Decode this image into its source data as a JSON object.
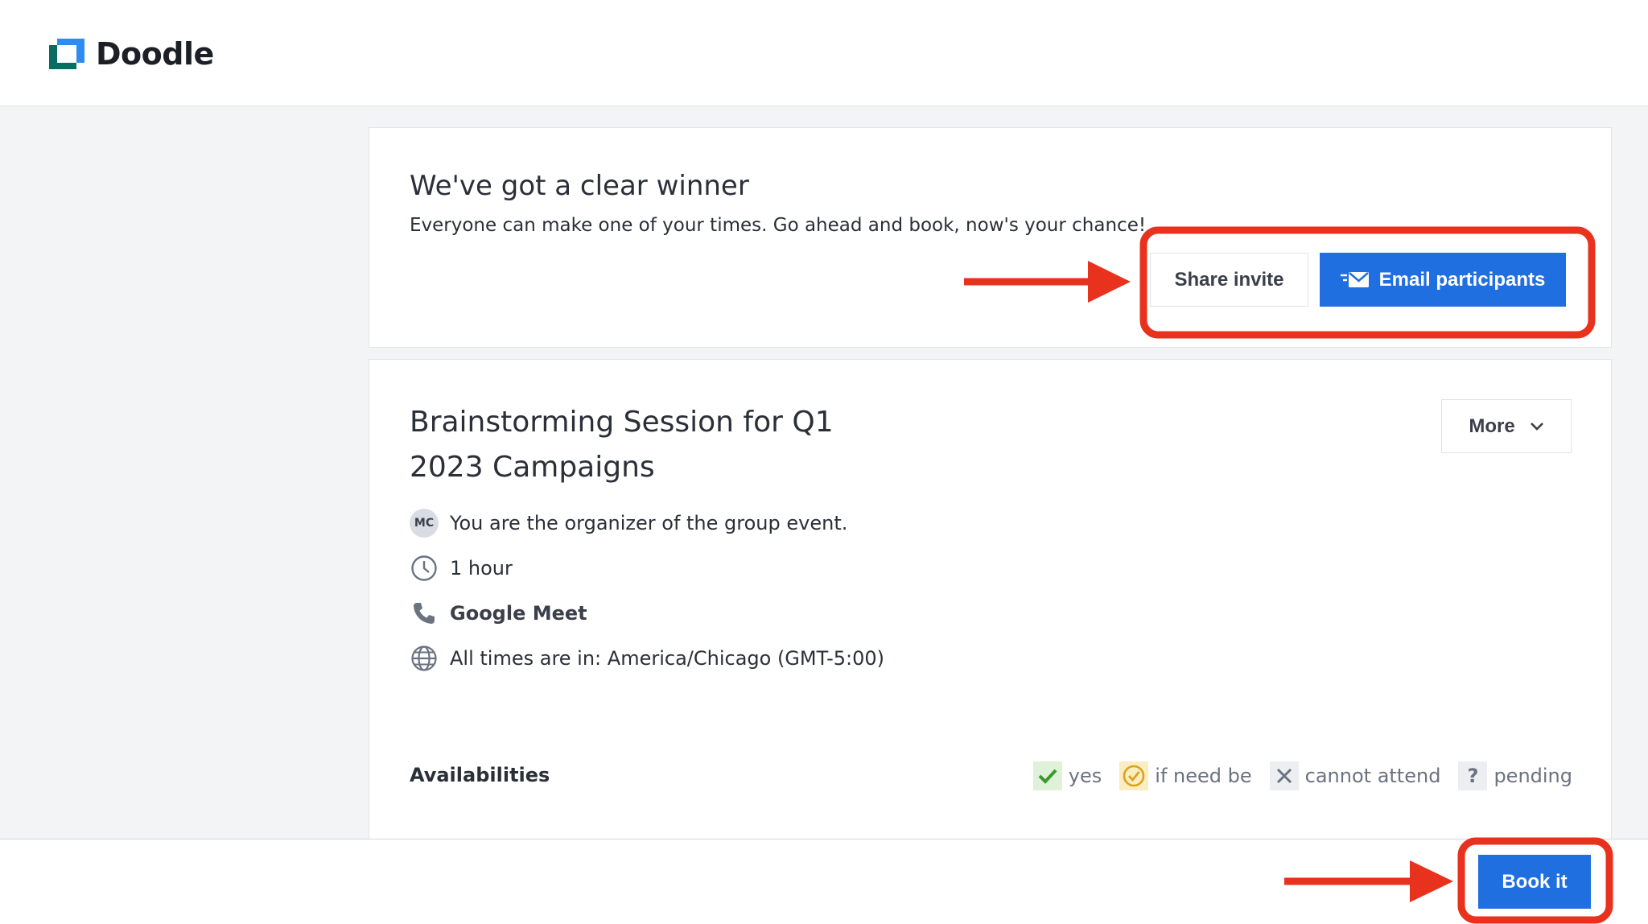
{
  "header": {
    "brand": "Doodle"
  },
  "winner": {
    "title": "We've got a clear winner",
    "subtitle": "Everyone can make one of your times. Go ahead and book, now's your chance!",
    "share_label": "Share invite",
    "email_label": "Email participants"
  },
  "event": {
    "title": "Brainstorming Session for Q1 2023 Campaigns",
    "more_label": "More",
    "organizer_initials": "MC",
    "organizer_text": "You are the organizer of the group event.",
    "duration": "1 hour",
    "location": "Google Meet",
    "timezone": "All times are in: America/Chicago (GMT-5:00)"
  },
  "availabilities": {
    "title": "Availabilities",
    "legend": {
      "yes": "yes",
      "if_need_be": "if need be",
      "cannot_attend": "cannot attend",
      "pending": "pending"
    }
  },
  "bottom_bar": {
    "book_label": "Book it"
  },
  "colors": {
    "primary_button": "#1f6fe0",
    "annotation": "#e8321e",
    "yes": "#3a9a2f",
    "if_need_be": "#d9a21b",
    "brand_teal": "#0a6b63",
    "brand_blue": "#2e8cf0"
  }
}
